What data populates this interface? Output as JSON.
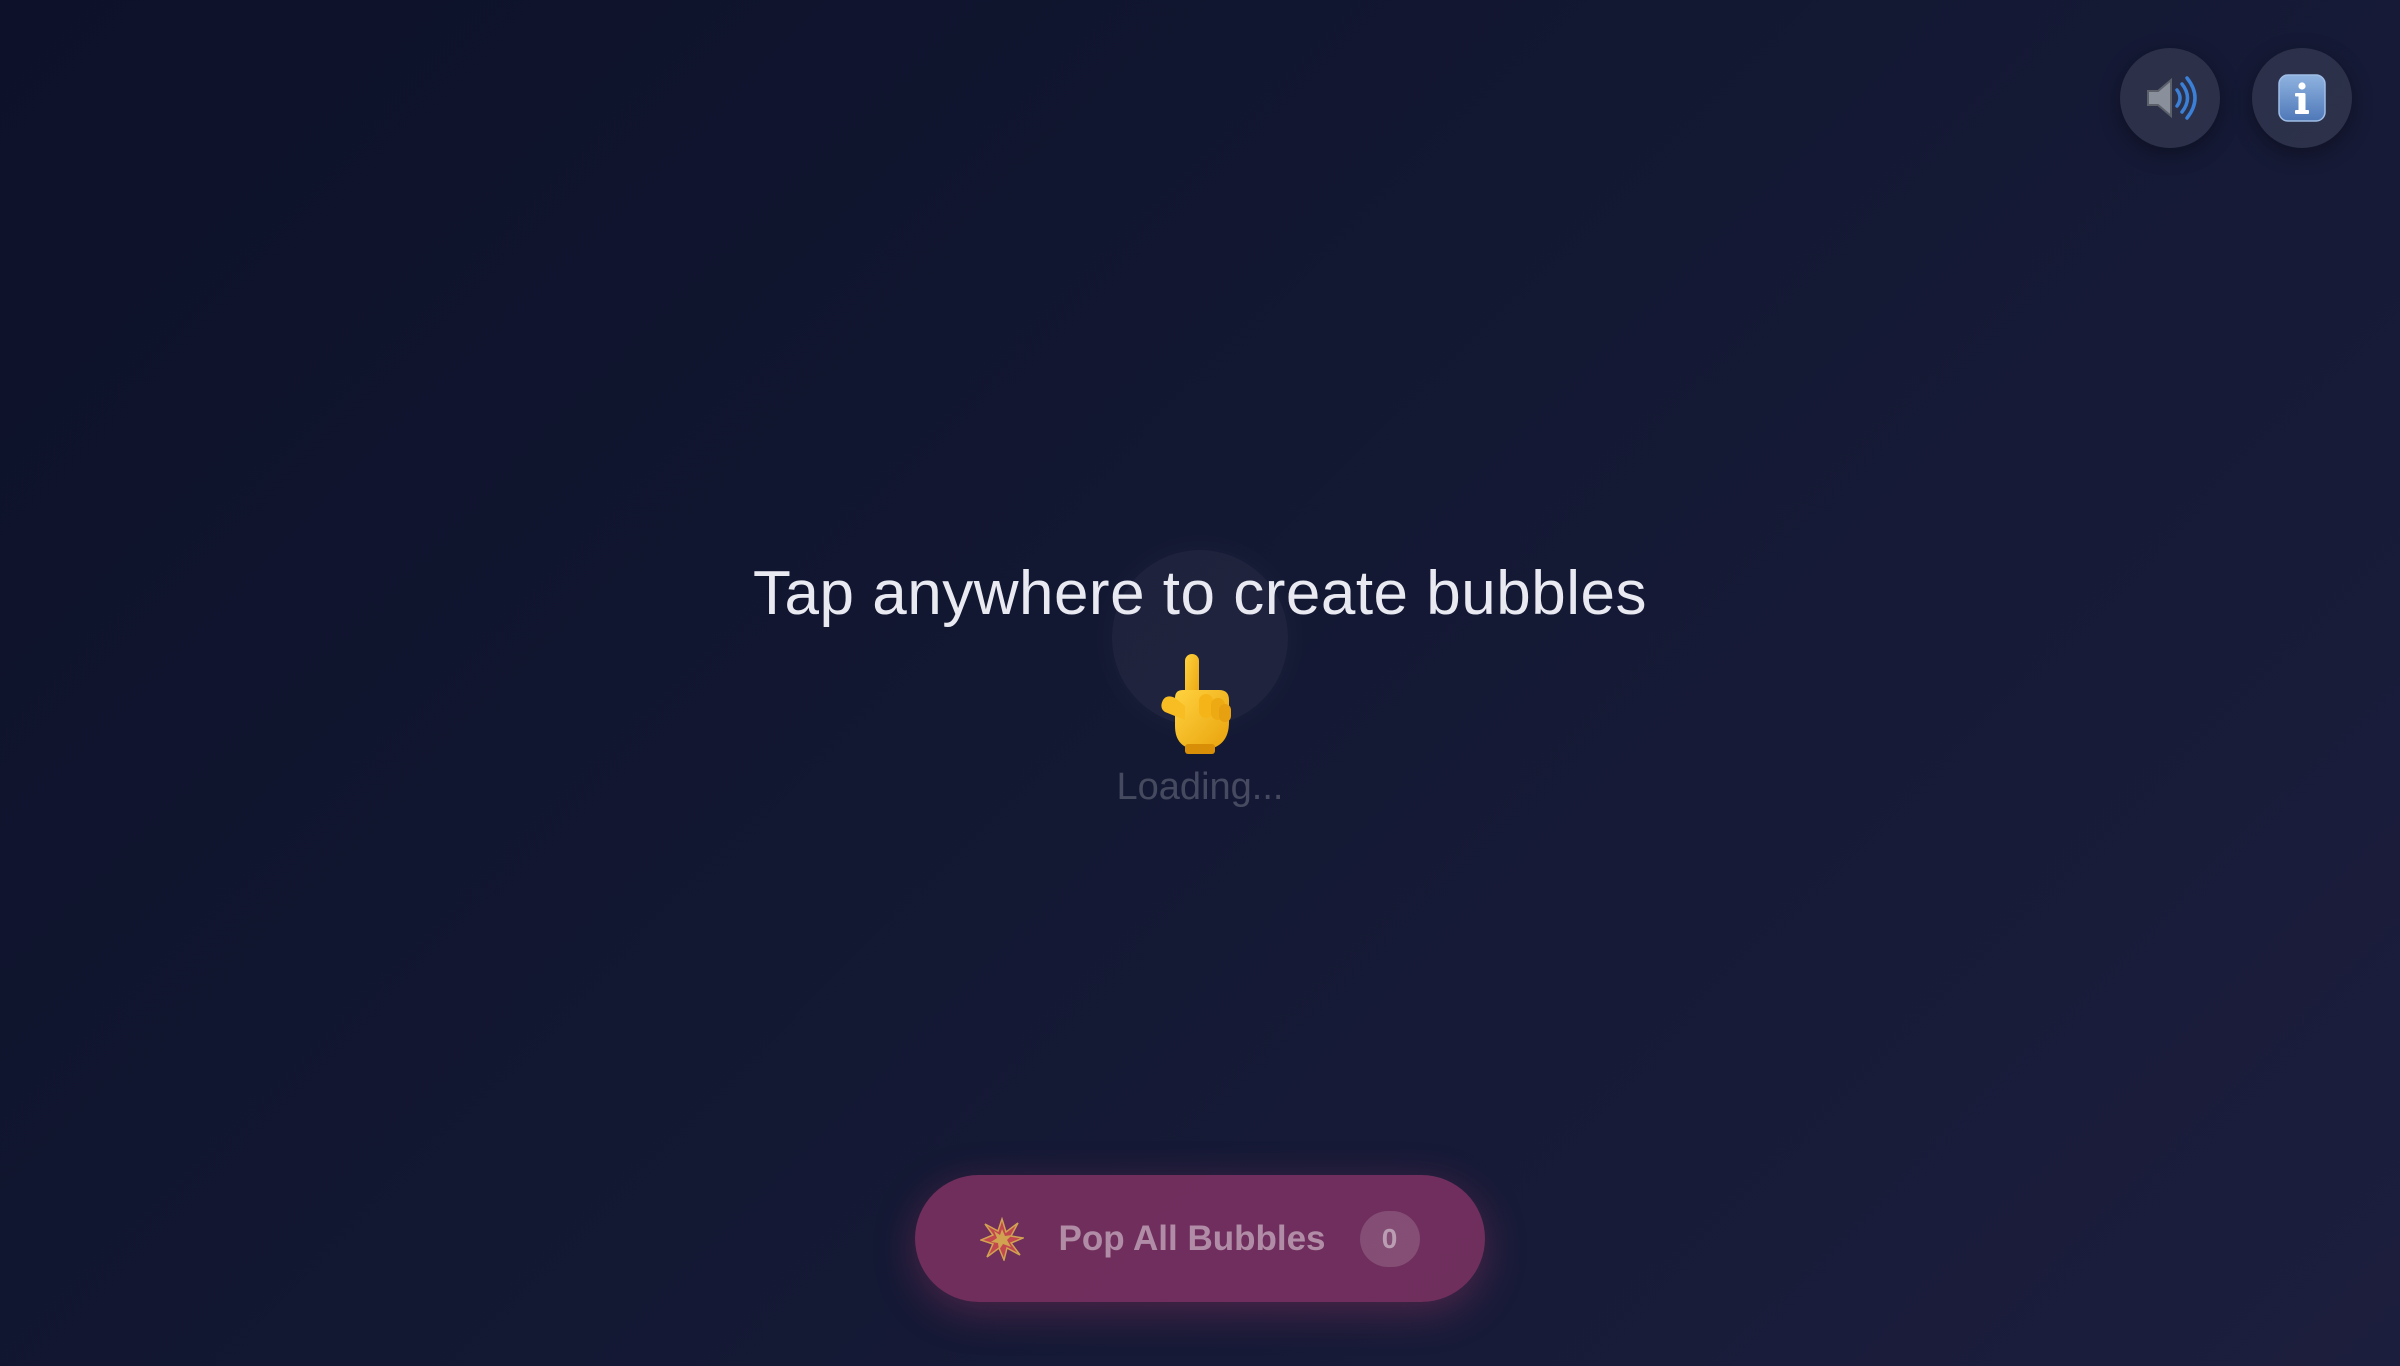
{
  "controls": {
    "sound_icon": "speaker-icon",
    "info_icon": "info-icon"
  },
  "main": {
    "headline": "Tap anywhere to create bubbles",
    "hint_icon": "pointing-hand-icon",
    "status": "Loading..."
  },
  "action": {
    "icon": "explosion-icon",
    "label": "Pop All Bubbles",
    "count": "0"
  },
  "colors": {
    "background": "#0d1129",
    "button_accent": "#96376e"
  }
}
